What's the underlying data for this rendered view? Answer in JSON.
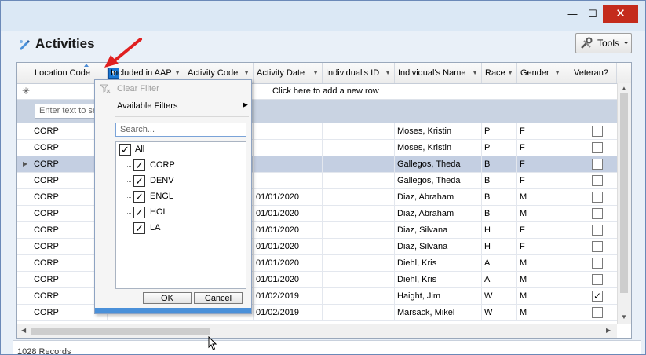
{
  "window": {
    "min_icon": "minimize-icon",
    "max_icon": "maximize-icon",
    "close_icon": "close-icon"
  },
  "header": {
    "title": "Activities",
    "tools_label": "Tools"
  },
  "grid": {
    "columns": [
      "Location Code",
      "Included in AAP",
      "Activity Code",
      "Activity Date",
      "Individual's ID",
      "Individual's Name",
      "Race",
      "Gender",
      "Veteran?"
    ],
    "new_row_text": "Click here to add a new row",
    "filter_placeholder": "Enter text to search",
    "rows": [
      {
        "location": "CORP",
        "date": "",
        "name": "Moses, Kristin",
        "race": "P",
        "gender": "F",
        "veteran": false,
        "selected": false
      },
      {
        "location": "CORP",
        "date": "",
        "name": "Moses, Kristin",
        "race": "P",
        "gender": "F",
        "veteran": false,
        "selected": false
      },
      {
        "location": "CORP",
        "date": "",
        "name": "Gallegos, Theda",
        "race": "B",
        "gender": "F",
        "veteran": false,
        "selected": true
      },
      {
        "location": "CORP",
        "date": "",
        "name": "Gallegos, Theda",
        "race": "B",
        "gender": "F",
        "veteran": false,
        "selected": false
      },
      {
        "location": "CORP",
        "date": "01/01/2020",
        "name": "Diaz, Abraham",
        "race": "B",
        "gender": "M",
        "veteran": false,
        "selected": false
      },
      {
        "location": "CORP",
        "date": "01/01/2020",
        "name": "Diaz, Abraham",
        "race": "B",
        "gender": "M",
        "veteran": false,
        "selected": false
      },
      {
        "location": "CORP",
        "date": "01/01/2020",
        "name": "Diaz, Silvana",
        "race": "H",
        "gender": "F",
        "veteran": false,
        "selected": false
      },
      {
        "location": "CORP",
        "date": "01/01/2020",
        "name": "Diaz, Silvana",
        "race": "H",
        "gender": "F",
        "veteran": false,
        "selected": false
      },
      {
        "location": "CORP",
        "date": "01/01/2020",
        "name": "Diehl, Kris",
        "race": "A",
        "gender": "M",
        "veteran": false,
        "selected": false
      },
      {
        "location": "CORP",
        "date": "01/01/2020",
        "name": "Diehl, Kris",
        "race": "A",
        "gender": "M",
        "veteran": false,
        "selected": false
      },
      {
        "location": "CORP",
        "date": "01/02/2019",
        "name": "Haight, Jim",
        "race": "W",
        "gender": "M",
        "veteran": true,
        "selected": false
      },
      {
        "location": "CORP",
        "date": "01/02/2019",
        "name": "Marsack, Mikel",
        "race": "W",
        "gender": "M",
        "veteran": false,
        "selected": false
      }
    ]
  },
  "filter_popup": {
    "clear_filter": "Clear Filter",
    "available_filters": "Available Filters",
    "search_placeholder": "Search...",
    "all_label": "All",
    "options": [
      "CORP",
      "DENV",
      "ENGL",
      "HOL",
      "LA"
    ],
    "ok_label": "OK",
    "cancel_label": "Cancel"
  },
  "footer": {
    "text": "1028 Records"
  }
}
